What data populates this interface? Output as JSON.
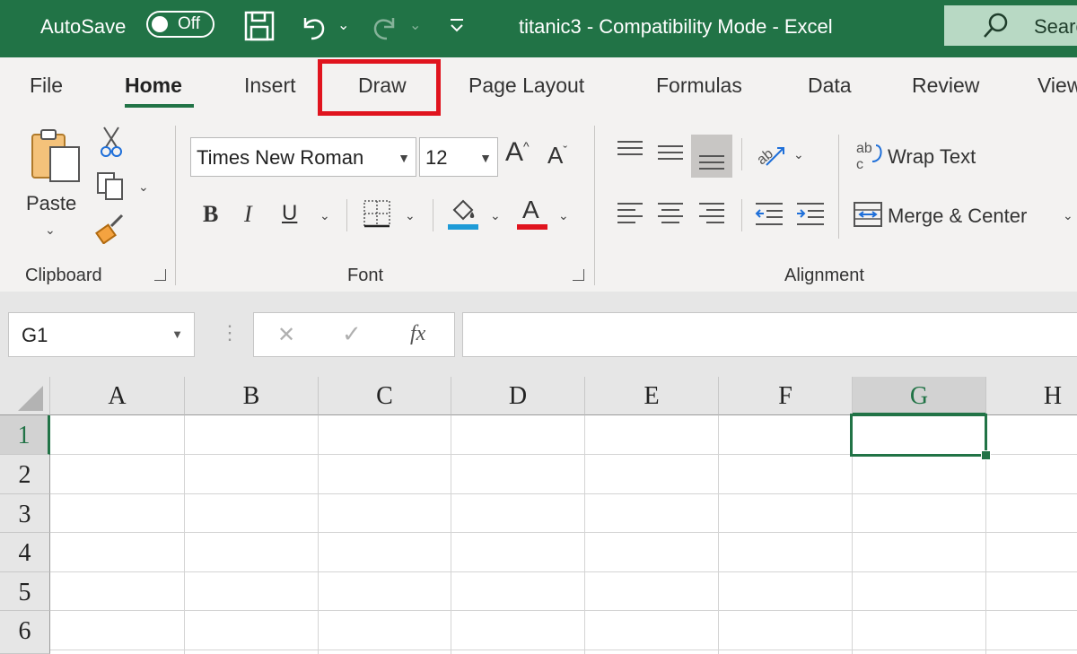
{
  "titlebar": {
    "autosave_label": "AutoSave",
    "autosave_state": "Off",
    "document_title": "titanic3  -  Compatibility Mode  -  Excel",
    "search_label": "Search",
    "color": "#217346"
  },
  "tabs": [
    "File",
    "Home",
    "Insert",
    "Draw",
    "Page Layout",
    "Formulas",
    "Data",
    "Review",
    "View"
  ],
  "active_tab": "Home",
  "highlighted_tab": "Draw",
  "highlight_color": "#e0141e",
  "clipboard": {
    "paste_label": "Paste",
    "group_label": "Clipboard"
  },
  "font": {
    "family": "Times New Roman",
    "size": "12",
    "bold_label": "B",
    "italic_label": "I",
    "underline_label": "U",
    "font_color_label": "A",
    "group_label": "Font",
    "fill_color": "#1e9bd7",
    "font_color": "#e0141e"
  },
  "alignment": {
    "wrap_text_label": "Wrap Text",
    "merge_center_label": "Merge & Center",
    "group_label": "Alignment"
  },
  "formula_bar": {
    "name_box": "G1",
    "cancel_symbol": "✕",
    "enter_symbol": "✓",
    "fx_label": "fx",
    "content": ""
  },
  "grid": {
    "columns": [
      "A",
      "B",
      "C",
      "D",
      "E",
      "F",
      "G",
      "H"
    ],
    "rows": [
      "1",
      "2",
      "3",
      "4",
      "5",
      "6"
    ],
    "selected_column": "G",
    "selected_row": "1"
  }
}
